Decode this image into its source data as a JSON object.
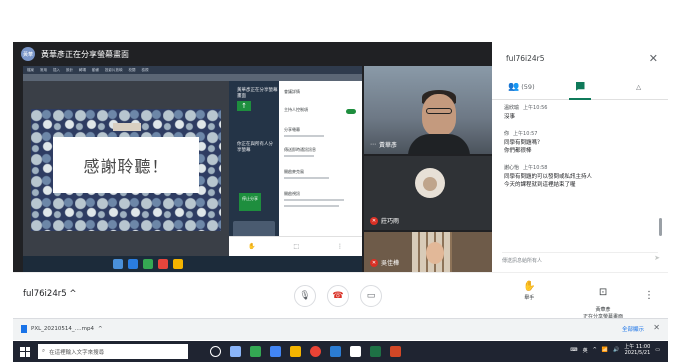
{
  "presenter": {
    "avatar": "黃華",
    "text": "黃華彥正在分享螢幕畫面"
  },
  "share_screen": {
    "menu_items": [
      "檔案",
      "常用",
      "插入",
      "設計",
      "轉場",
      "動畫",
      "投影片放映",
      "校閱",
      "檢視"
    ],
    "slide_text": "感謝聆聽！",
    "mini_panel": {
      "left_title": "黃華彥正在分享螢幕畫面",
      "left_sub": "你正在與所有人分享螢幕",
      "green_btn": "停止分享",
      "rows": [
        "會議詳情",
        "主持人控制項",
        "分享螢幕",
        "傳送即時通訊訊息",
        "開啟麥克風",
        "開啟視訊"
      ],
      "bottom_icons": [
        "✋",
        "⬚",
        "⋮"
      ]
    }
  },
  "participants": [
    {
      "name": "黃華彥",
      "muted": false
    },
    {
      "name": "莊巧雨",
      "muted": true
    },
    {
      "name": "吳佳樺",
      "muted": true
    }
  ],
  "chat": {
    "meeting_code": "ful76i24r5",
    "close_icon": "close-icon",
    "tabs": [
      {
        "name": "people",
        "label": "(59)",
        "icon": "people-icon"
      },
      {
        "name": "chat",
        "label": "",
        "icon": "chat-icon"
      },
      {
        "name": "activities",
        "label": "",
        "icon": "activities-icon"
      }
    ],
    "messages": [
      {
        "sender": "溫欣瑜",
        "time": "上午10:56",
        "text": "沒事"
      },
      {
        "sender": "你",
        "time": "上午10:57",
        "text": "同學有問題嗎？\n你們都很棒"
      },
      {
        "sender": "謝心怡",
        "time": "上午10:58",
        "text": "同學有問題的可以發問或私訊主持人\n今天的課程就到這裡結束了喔"
      }
    ],
    "input_placeholder": "傳送訊息給所有人"
  },
  "bottom_bar": {
    "meeting_code": "ful76i24r5",
    "raise_hand_label": "舉手",
    "present_label": "黃華彥\n正在分享螢幕畫面"
  },
  "download_bar": {
    "file_name": "PXL_20210514_....mp4",
    "show_all": "全部顯示"
  },
  "taskbar": {
    "search_placeholder": "在這裡輸入文字來搜尋",
    "tray_lang": "英",
    "time": "上午 11:00",
    "date": "2021/5/21"
  },
  "colors": {
    "accent": "#0f7a5a",
    "end_call": "#d93025",
    "dark_stage": "#202124"
  }
}
